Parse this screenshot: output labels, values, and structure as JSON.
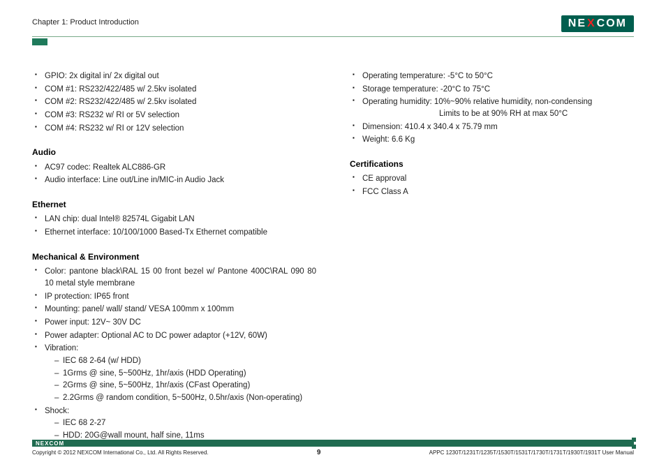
{
  "header": {
    "chapter": "Chapter 1: Product Introduction",
    "logo_left": "NE",
    "logo_x": "X",
    "logo_right": "COM"
  },
  "left": {
    "top_bullets": [
      "GPIO: 2x digital in/ 2x digital out",
      "COM #1: RS232/422/485 w/ 2.5kv isolated",
      "COM #2: RS232/422/485 w/ 2.5kv isolated",
      "COM #3: RS232 w/ RI or 5V selection",
      "COM #4: RS232 w/ RI or 12V selection"
    ],
    "audio_title": "Audio",
    "audio_bullets": [
      "AC97 codec: Realtek ALC886-GR",
      "Audio interface: Line out/Line in/MIC-in Audio Jack"
    ],
    "eth_title": "Ethernet",
    "eth_bullets": [
      "LAN chip: dual Intel® 82574L Gigabit LAN",
      "Ethernet interface: 10/100/1000 Based-Tx Ethernet compatible"
    ],
    "mech_title": "Mechanical & Environment",
    "mech_b0": "Color: pantone black\\RAL 15 00 front bezel w/ Pantone 400C\\RAL 090 80 10 metal style membrane",
    "mech_b1": "IP protection: IP65 front",
    "mech_b2": "Mounting: panel/ wall/ stand/ VESA 100mm x 100mm",
    "mech_b3": "Power input: 12V~ 30V DC",
    "mech_b4": "Power adapter: Optional AC to DC power adaptor (+12V, 60W)",
    "mech_vib_label": "Vibration:",
    "mech_vib": [
      "IEC 68 2-64 (w/ HDD)",
      "1Grms @ sine, 5~500Hz, 1hr/axis (HDD Operating)",
      "2Grms @ sine, 5~500Hz, 1hr/axis (CFast Operating)",
      "2.2Grms @ random condition, 5~500Hz, 0.5hr/axis (Non-operating)"
    ],
    "mech_shock_label": "Shock:",
    "mech_shock": [
      "IEC 68 2-27",
      "HDD: 20G@wall mount, half sine, 11ms"
    ]
  },
  "right": {
    "env_bullets_a": [
      "Operating temperature: -5°C to 50°C",
      "Storage temperature: -20°C to 75°C",
      "Operating humidity: 10%~90% relative humidity, non-condensing"
    ],
    "env_note": "Limits to be at 90% RH at max 50°C",
    "env_bullets_b": [
      "Dimension: 410.4 x 340.4 x 75.79 mm",
      "Weight: 6.6 Kg"
    ],
    "cert_title": "Certifications",
    "cert_bullets": [
      "CE approval",
      "FCC Class A"
    ]
  },
  "footer": {
    "logo": "NEXCOM",
    "copyright": "Copyright © 2012 NEXCOM International Co., Ltd. All Rights Reserved.",
    "page": "9",
    "manual": "APPC 1230T/1231T/1235T/1530T/1531T/1730T/1731T/1930T/1931T User Manual"
  }
}
